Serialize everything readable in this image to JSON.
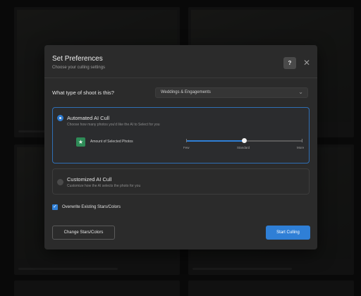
{
  "dialog": {
    "title": "Set Preferences",
    "subtitle": "Choose your culling settings",
    "help_label": "?",
    "close_glyph": "✕"
  },
  "shoot_type": {
    "question": "What type of shoot is this?",
    "selected": "Weddings & Engagements",
    "chevron": "⌄"
  },
  "auto_cull": {
    "title": "Automated AI Cull",
    "description": "Choose how many photos you'd like the AI to Select for you",
    "selected": true,
    "amount_label": "Amount of Selected Photos",
    "star_glyph": "★",
    "slider": {
      "labels": [
        "Few",
        "Standard",
        "More"
      ],
      "value_fraction": 0.5
    }
  },
  "custom_cull": {
    "title": "Customized AI Cull",
    "description": "Customize how the AI selects the photo for you",
    "selected": false
  },
  "overwrite": {
    "label": "Overwrite Existing Stars/Colors",
    "checked": true,
    "check_glyph": "✓"
  },
  "buttons": {
    "change_stars": "Change Stars/Colors",
    "start": "Start Culling"
  },
  "colors": {
    "accent": "#2f7fd6",
    "star_badge": "#2e8b57",
    "dialog_bg": "#2b2b2b"
  }
}
